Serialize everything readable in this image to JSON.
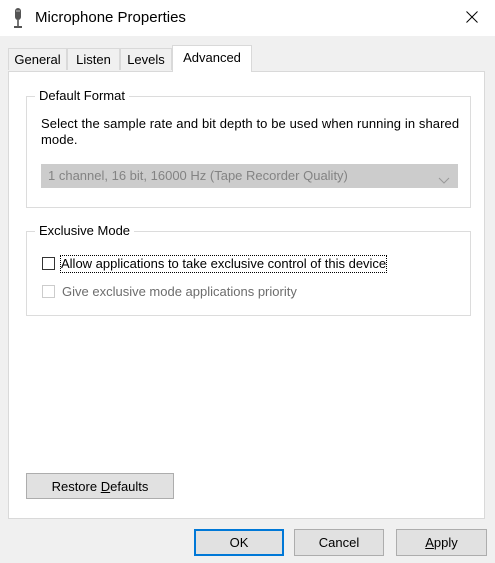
{
  "window": {
    "title": "Microphone Properties",
    "accent_color": "#0078d7"
  },
  "tabs": [
    {
      "label": "General"
    },
    {
      "label": "Listen"
    },
    {
      "label": "Levels"
    },
    {
      "label": "Advanced",
      "selected": true
    }
  ],
  "default_format": {
    "legend": "Default Format",
    "description": "Select the sample rate and bit depth to be used when running in shared mode.",
    "selected_format": "1 channel, 16 bit, 16000 Hz (Tape Recorder Quality)"
  },
  "exclusive_mode": {
    "legend": "Exclusive Mode",
    "allow_exclusive": {
      "label": "Allow applications to take exclusive control of this device",
      "checked": false
    },
    "priority": {
      "label": "Give exclusive mode applications priority",
      "checked": false,
      "disabled": true
    }
  },
  "buttons": {
    "restore_defaults": {
      "label_prefix": "Restore ",
      "label_accel": "D",
      "label_suffix": "efaults"
    },
    "ok": "OK",
    "cancel": "Cancel",
    "apply": {
      "label_accel": "A",
      "label_suffix": "pply"
    }
  },
  "icons": {
    "app": "microphone-icon",
    "close": "close-icon",
    "dropdown": "chevron-down-icon"
  }
}
